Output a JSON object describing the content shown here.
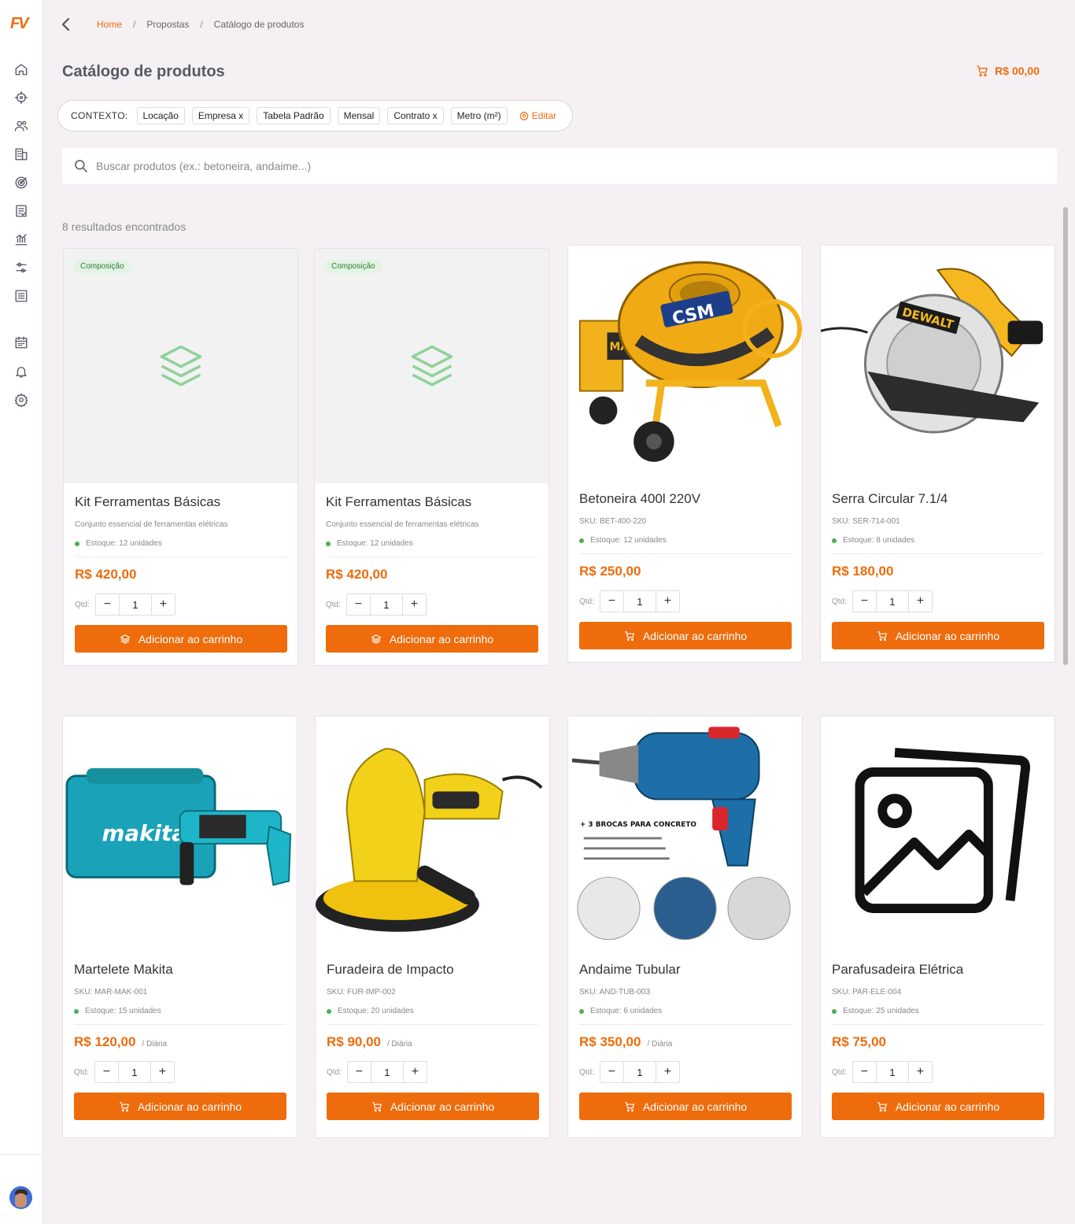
{
  "app": {
    "logo": "FV"
  },
  "breadcrumb": {
    "home": "Home",
    "propostas": "Propostas",
    "current": "Catálogo de produtos",
    "sep": "/"
  },
  "page": {
    "title": "Catálogo de produtos",
    "cart_total": "R$ 00,00"
  },
  "context": {
    "label": "CONTEXTO:",
    "chips": [
      "Locação",
      "Empresa x",
      "Tabela Padrão",
      "Mensal",
      "Contrato x",
      "Metro (m²)"
    ],
    "edit": "Editar"
  },
  "search": {
    "placeholder": "Buscar produtos (ex.: betoneira, andaime...)"
  },
  "results": {
    "count_text": "8 resultados encontrados"
  },
  "labels": {
    "qty": "Qtd:",
    "add": "Adicionar ao carrinho",
    "badge": "Composição"
  },
  "colors": {
    "accent": "#ee6c0c",
    "stock": "#4caf50",
    "badge_bg": "#e3f3e4",
    "badge_text": "#2e7d32"
  },
  "products": [
    {
      "name": "Kit Ferramentas Básicas",
      "sub": "Conjunto essencial de ferramentas elétricas",
      "stock": "Estoque: 12 unidades",
      "price": "R$ 420,00",
      "unit": "",
      "qty": "1",
      "image": "layers-icon",
      "badge": true
    },
    {
      "name": "Kit Ferramentas Básicas",
      "sub": "Conjunto essencial de ferramentas elétricas",
      "stock": "Estoque: 12 unidades",
      "price": "R$ 420,00",
      "unit": "",
      "qty": "1",
      "image": "layers-icon",
      "badge": true
    },
    {
      "name": "Betoneira 400l 220V",
      "sub": "SKU: BET-400-220",
      "stock": "Estoque: 12 unidades",
      "price": "R$ 250,00",
      "unit": "",
      "qty": "1",
      "image": "cement-mixer",
      "badge": false
    },
    {
      "name": "Serra Circular 7.1/4",
      "sub": "SKU: SER-714-001",
      "stock": "Estoque: 8 unidades",
      "price": "R$ 180,00",
      "unit": "",
      "qty": "1",
      "image": "circular-saw",
      "badge": false
    },
    {
      "name": "Martelete Makita",
      "sub": "SKU: MAR-MAK-001",
      "stock": "Estoque: 15 unidades",
      "price": "R$ 120,00",
      "unit": "/ Diária",
      "qty": "1",
      "image": "rotary-hammer",
      "badge": false
    },
    {
      "name": "Furadeira de Impacto",
      "sub": "SKU: FUR-IMP-002",
      "stock": "Estoque: 20 unidades",
      "price": "R$ 90,00",
      "unit": "/ Diária",
      "qty": "1",
      "image": "wall-sander",
      "badge": false
    },
    {
      "name": "Andaime Tubular",
      "sub": "SKU: AND-TUB-003",
      "stock": "Estoque: 6 unidades",
      "price": "R$ 350,00",
      "unit": "/ Diária",
      "qty": "1",
      "image": "impact-drill",
      "badge": false
    },
    {
      "name": "Parafusadeira Elétrica",
      "sub": "SKU: PAR-ELE-004",
      "stock": "Estoque: 25 unidades",
      "price": "R$ 75,00",
      "unit": "",
      "qty": "1",
      "image": "image-placeholder-icon",
      "badge": false
    }
  ]
}
